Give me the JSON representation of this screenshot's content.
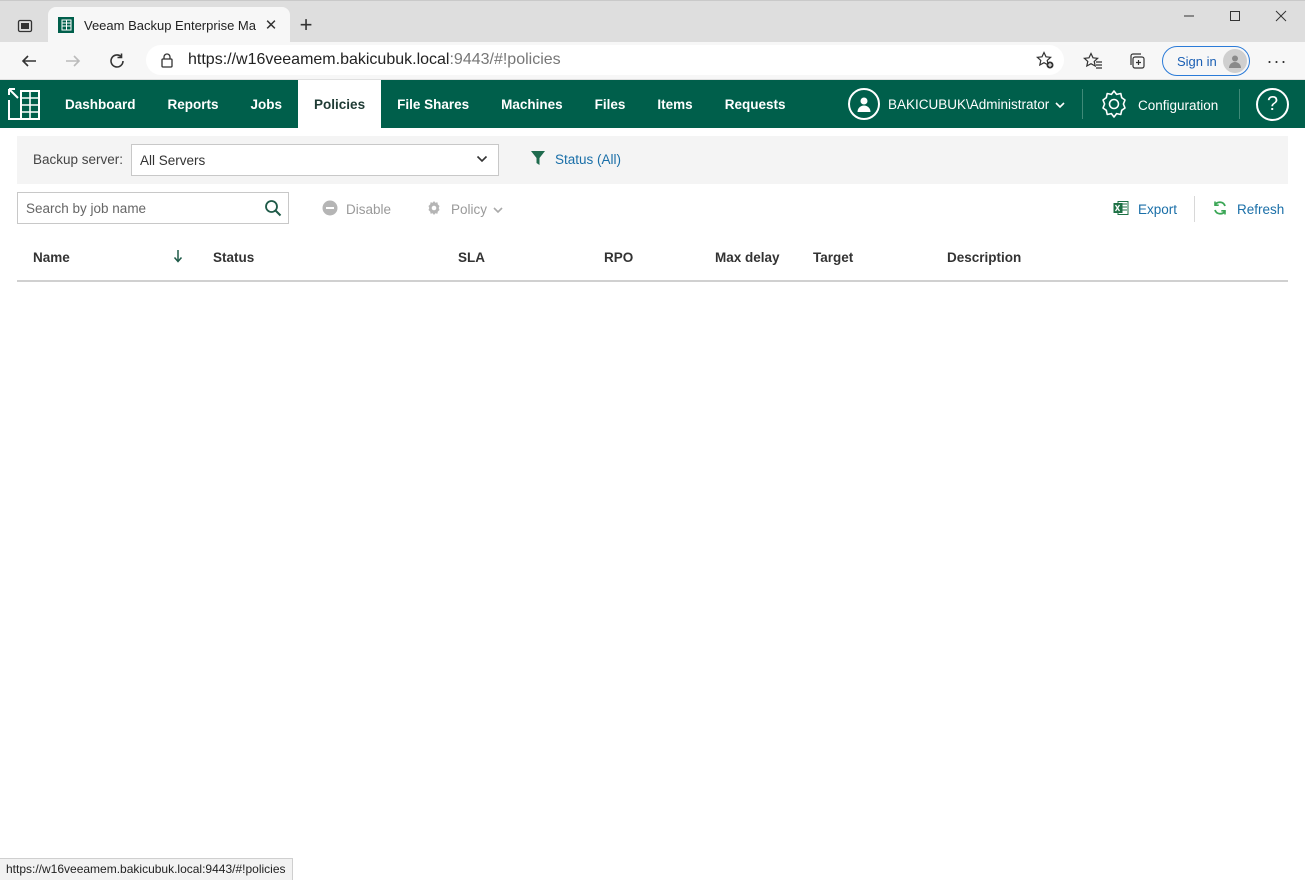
{
  "browser": {
    "tab_title": "Veeam Backup Enterprise Manag",
    "url_host": "https://w16veeamem.bakicubuk.local",
    "url_path": ":9443/#!policies",
    "sign_in_label": "Sign in",
    "status_url": "https://w16veeamem.bakicubuk.local:9443/#!policies"
  },
  "app": {
    "nav": [
      {
        "label": "Dashboard"
      },
      {
        "label": "Reports"
      },
      {
        "label": "Jobs"
      },
      {
        "label": "Policies",
        "active": true
      },
      {
        "label": "File Shares"
      },
      {
        "label": "Machines"
      },
      {
        "label": "Files"
      },
      {
        "label": "Items"
      },
      {
        "label": "Requests"
      }
    ],
    "user": "BAKICUBUK\\Administrator",
    "config_label": "Configuration",
    "help_label": "?",
    "brand_color": "#005f4b"
  },
  "filter": {
    "backup_server_label": "Backup server:",
    "backup_server_value": "All Servers",
    "status_label": "Status (All)"
  },
  "toolbar": {
    "search_placeholder": "Search by job name",
    "disable_label": "Disable",
    "policy_label": "Policy",
    "export_label": "Export",
    "refresh_label": "Refresh"
  },
  "table": {
    "columns": [
      "Name",
      "Status",
      "SLA",
      "RPO",
      "Max delay",
      "Target",
      "Description"
    ],
    "rows": []
  }
}
